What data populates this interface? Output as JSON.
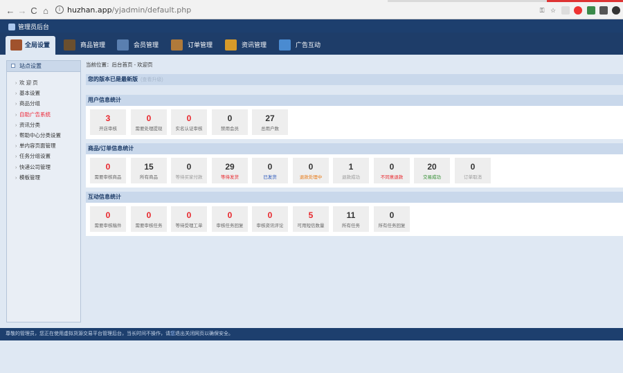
{
  "browser": {
    "url_host": "huzhan.app",
    "url_path": "/yjadmin/default.php",
    "back": "←",
    "forward": "→",
    "reload": "C",
    "home": "⌂"
  },
  "header": {
    "title": "管理员后台"
  },
  "nav": {
    "tabs": [
      {
        "label": "全局设置",
        "icon": "settings-icon",
        "color": "#a0522d"
      },
      {
        "label": "商品管理",
        "icon": "goods-icon",
        "color": "#6b4f2e"
      },
      {
        "label": "会员管理",
        "icon": "member-icon",
        "color": "#5a7fb0"
      },
      {
        "label": "订单管理",
        "icon": "order-icon",
        "color": "#b07a3a"
      },
      {
        "label": "资讯管理",
        "icon": "news-icon",
        "color": "#d69a2a"
      },
      {
        "label": "广告互动",
        "icon": "ad-icon",
        "color": "#4a8bd1"
      }
    ]
  },
  "sidebar": {
    "title": "站点设置",
    "items": [
      {
        "label": "欢 迎 页"
      },
      {
        "label": "基本设置"
      },
      {
        "label": "商品分组"
      },
      {
        "label": "自助广告系统",
        "highlight": true
      },
      {
        "label": "资讯分类"
      },
      {
        "label": "帮助中心分类设置"
      },
      {
        "label": "单内容页面管理"
      },
      {
        "label": "任务分组设置"
      },
      {
        "label": "快递公司管理"
      },
      {
        "label": "模板管理"
      }
    ]
  },
  "main": {
    "breadcrumb": "当前位置：后台首页 - 欢迎页",
    "notice": "您的版本已是最新版",
    "notice_sub": "(查看升级)",
    "panels": [
      {
        "title": "用户信息统计",
        "cards": [
          {
            "value": "3",
            "label": "开店审核",
            "value_color": "red",
            "label_color": ""
          },
          {
            "value": "0",
            "label": "需要处理提现",
            "value_color": "red",
            "label_color": ""
          },
          {
            "value": "0",
            "label": "实名认证审核",
            "value_color": "red",
            "label_color": ""
          },
          {
            "value": "0",
            "label": "禁用会员",
            "value_color": "",
            "label_color": ""
          },
          {
            "value": "27",
            "label": "总用户数",
            "value_color": "",
            "label_color": ""
          }
        ]
      },
      {
        "title": "商品/订单信息统计",
        "cards": [
          {
            "value": "0",
            "label": "需要审核商品",
            "value_color": "red",
            "label_color": ""
          },
          {
            "value": "15",
            "label": "所有商品",
            "value_color": "",
            "label_color": ""
          },
          {
            "value": "0",
            "label": "等待买家付款",
            "value_color": "",
            "label_color": "gray"
          },
          {
            "value": "29",
            "label": "等待发货",
            "value_color": "",
            "label_color": "red"
          },
          {
            "value": "0",
            "label": "已发货",
            "value_color": "",
            "label_color": "blue"
          },
          {
            "value": "0",
            "label": "退款处理中",
            "value_color": "",
            "label_color": "orange"
          },
          {
            "value": "1",
            "label": "退款成功",
            "value_color": "",
            "label_color": "gray"
          },
          {
            "value": "0",
            "label": "不同意退款",
            "value_color": "",
            "label_color": "red"
          },
          {
            "value": "20",
            "label": "交易成功",
            "value_color": "",
            "label_color": "green"
          },
          {
            "value": "0",
            "label": "订单取消",
            "value_color": "",
            "label_color": "gray"
          }
        ]
      },
      {
        "title": "互动信息统计",
        "cards": [
          {
            "value": "0",
            "label": "需要审核稿件",
            "value_color": "red",
            "label_color": ""
          },
          {
            "value": "0",
            "label": "需要审核任务",
            "value_color": "red",
            "label_color": ""
          },
          {
            "value": "0",
            "label": "等待受理工单",
            "value_color": "red",
            "label_color": ""
          },
          {
            "value": "0",
            "label": "审核任务回复",
            "value_color": "red",
            "label_color": ""
          },
          {
            "value": "0",
            "label": "审核资讯评论",
            "value_color": "red",
            "label_color": ""
          },
          {
            "value": "5",
            "label": "可用短信数量",
            "value_color": "red",
            "label_color": ""
          },
          {
            "value": "11",
            "label": "所有任务",
            "value_color": "",
            "label_color": ""
          },
          {
            "value": "0",
            "label": "所有任务回复",
            "value_color": "",
            "label_color": ""
          }
        ]
      }
    ]
  },
  "footer": {
    "text_before": "尊敬的管理员，您正在使用虚拟货源交易平台管理后台，当长时间不操作，请",
    "text_highlight": "您",
    "text_after": "退出关闭网页以确保安全。"
  }
}
